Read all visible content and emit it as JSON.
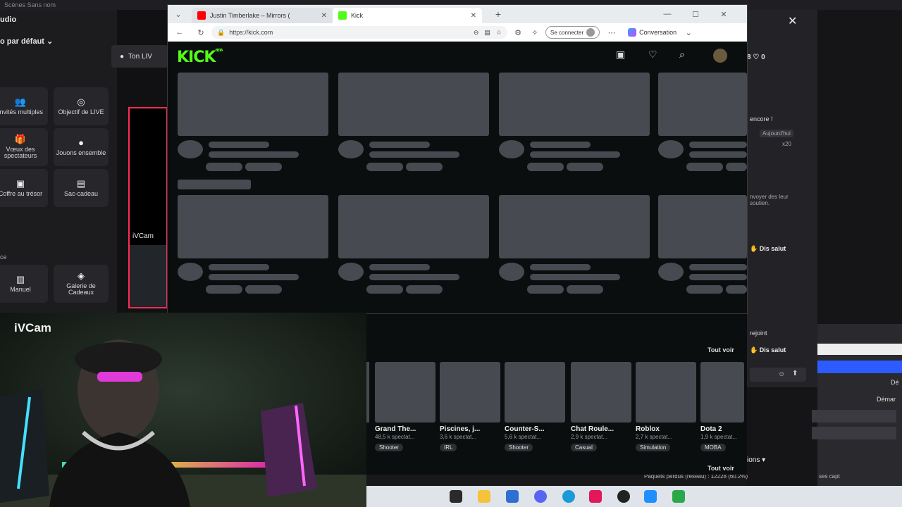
{
  "bg_app": {
    "title": "Scènes Sans nom",
    "studio_label": "udio",
    "audio_dropdown": "o par défaut",
    "scene_button": "Ton LIV",
    "tiles": [
      {
        "icon": "users-icon",
        "label": "Invités multiples"
      },
      {
        "icon": "target-icon",
        "label": "Objectif de LIVE"
      },
      {
        "icon": "gift-icon",
        "label": "Vœux des spectateurs"
      },
      {
        "icon": "joystick-icon",
        "label": "Jouons ensemble"
      },
      {
        "icon": "chest-icon",
        "label": "Coffre au trésor"
      },
      {
        "icon": "bag-icon",
        "label": "Sac-cadeau"
      },
      {
        "icon": "book-icon",
        "label": "Manuel"
      },
      {
        "icon": "gallery-icon",
        "label": "Galerie de Cadeaux"
      }
    ],
    "section_label": "ce",
    "preview_label": "iVCam",
    "right_panel": {
      "stats": "8   ♡ 0",
      "note1": "encore !",
      "note2": "Aujourd'hui",
      "note3": "x20",
      "send_support": "nvoyer des leur soutien.",
      "say_hi_1": "Dis salut",
      "joined": "rejoint",
      "say_hi_2": "Dis salut",
      "options": "ions",
      "demarrer_1": "Dé",
      "demarrer_2": "Démar",
      "stats_bar": "Paquets perdus (réseau) : 12228 (60.2%)",
      "frames": "ses capt"
    }
  },
  "browser": {
    "tabs": [
      {
        "title": "Justin Timberlake – Mirrors (",
        "active": false,
        "favicon_color": "#ff0000"
      },
      {
        "title": "Kick",
        "active": true,
        "favicon_color": "#53fc18"
      }
    ],
    "url": "https://kick.com",
    "signin_label": "Se connecter",
    "copilot_label": "Conversation",
    "logo": "KICK",
    "logo_badge": "BETA",
    "top_icons": [
      "tv-icon",
      "heart-icon",
      "search-icon",
      "avatar-icon"
    ],
    "see_all_1": "Tout voir",
    "see_all_2": "Tout voir",
    "categories": [
      {
        "name": "Grand The...",
        "viewers": "48,5 k spectat...",
        "tag": "Shooter"
      },
      {
        "name": "Piscines, j...",
        "viewers": "3,6 k spectat...",
        "tag": "IRL"
      },
      {
        "name": "Counter-S...",
        "viewers": "5,6 k spectat...",
        "tag": "Shooter"
      },
      {
        "name": "Chat Roule...",
        "viewers": "2,9 k spectat...",
        "tag": "Casual"
      },
      {
        "name": "Roblox",
        "viewers": "2,7 k spectat...",
        "tag": "Simulation"
      },
      {
        "name": "Dota 2",
        "viewers": "1,9 k spectat...",
        "tag": "MOBA"
      }
    ]
  },
  "webcam": {
    "label": "iVCam"
  },
  "taskbar": {
    "icons": [
      {
        "name": "task-view-icon",
        "color": "#2a2a2a"
      },
      {
        "name": "file-explorer-icon",
        "color": "#f3c43a"
      },
      {
        "name": "store-icon",
        "color": "#2f6fd1"
      },
      {
        "name": "discord-icon",
        "color": "#5865f2"
      },
      {
        "name": "edge-icon",
        "color": "#1a9ad6"
      },
      {
        "name": "tiktok-icon",
        "color": "#e3175a"
      },
      {
        "name": "obs-icon",
        "color": "#222222"
      },
      {
        "name": "ivcam-icon",
        "color": "#1f8fff"
      },
      {
        "name": "vpn-icon",
        "color": "#2aa84a"
      }
    ]
  }
}
